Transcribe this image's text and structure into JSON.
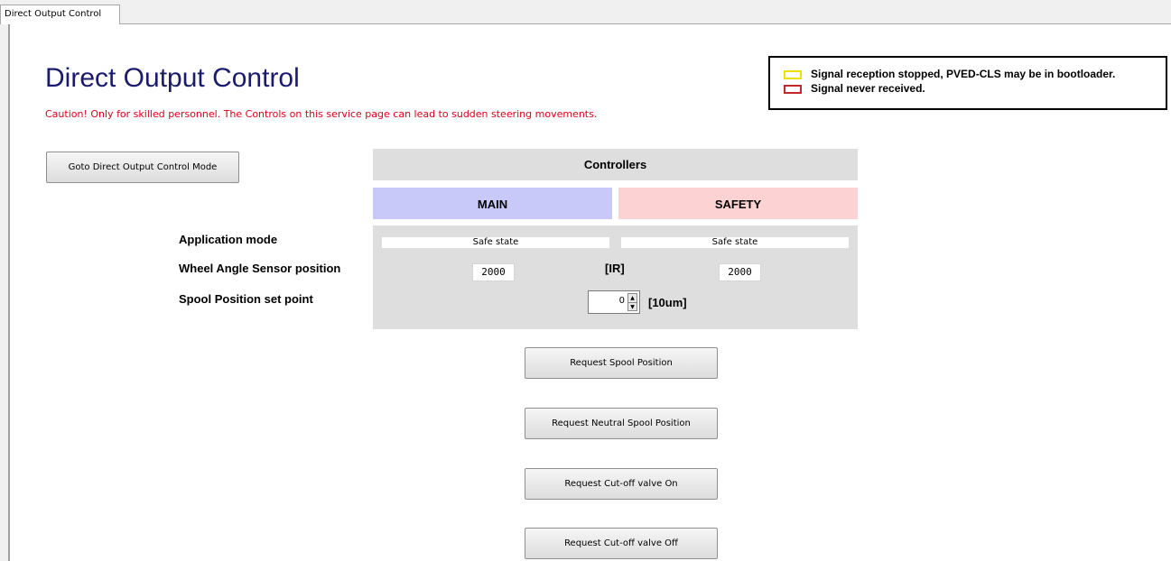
{
  "tab": {
    "label": "Direct Output Control"
  },
  "page": {
    "title": "Direct Output Control",
    "caution": "Caution! Only for skilled personnel. The Controls on this service page can lead to sudden steering movements."
  },
  "legend": {
    "items": [
      {
        "text": "Signal reception stopped, PVED-CLS may be in bootloader.",
        "color": "#f0e000"
      },
      {
        "text": "Signal never received.",
        "color": "#c0282b"
      }
    ]
  },
  "goto_button": {
    "label": "Goto Direct Output Control Mode"
  },
  "controllers": {
    "header": "Controllers",
    "main_label": "MAIN",
    "safety_label": "SAFETY",
    "main_color": "#c9c9f9",
    "safety_color": "#fcd2d2"
  },
  "rows": {
    "application_mode": {
      "label": "Application mode",
      "main": "Safe state",
      "safety": "Safe state"
    },
    "wheel_angle": {
      "label": "Wheel Angle Sensor position",
      "main": "2000",
      "safety": "2000",
      "unit": "[IR]"
    },
    "spool_setpoint": {
      "label": "Spool Position set point",
      "value": "0",
      "unit": "[10um]"
    }
  },
  "actions": {
    "request_spool": "Request Spool Position",
    "request_neutral": "Request Neutral Spool Position",
    "cutoff_on": "Request Cut-off valve On",
    "cutoff_off": "Request Cut-off valve Off"
  }
}
